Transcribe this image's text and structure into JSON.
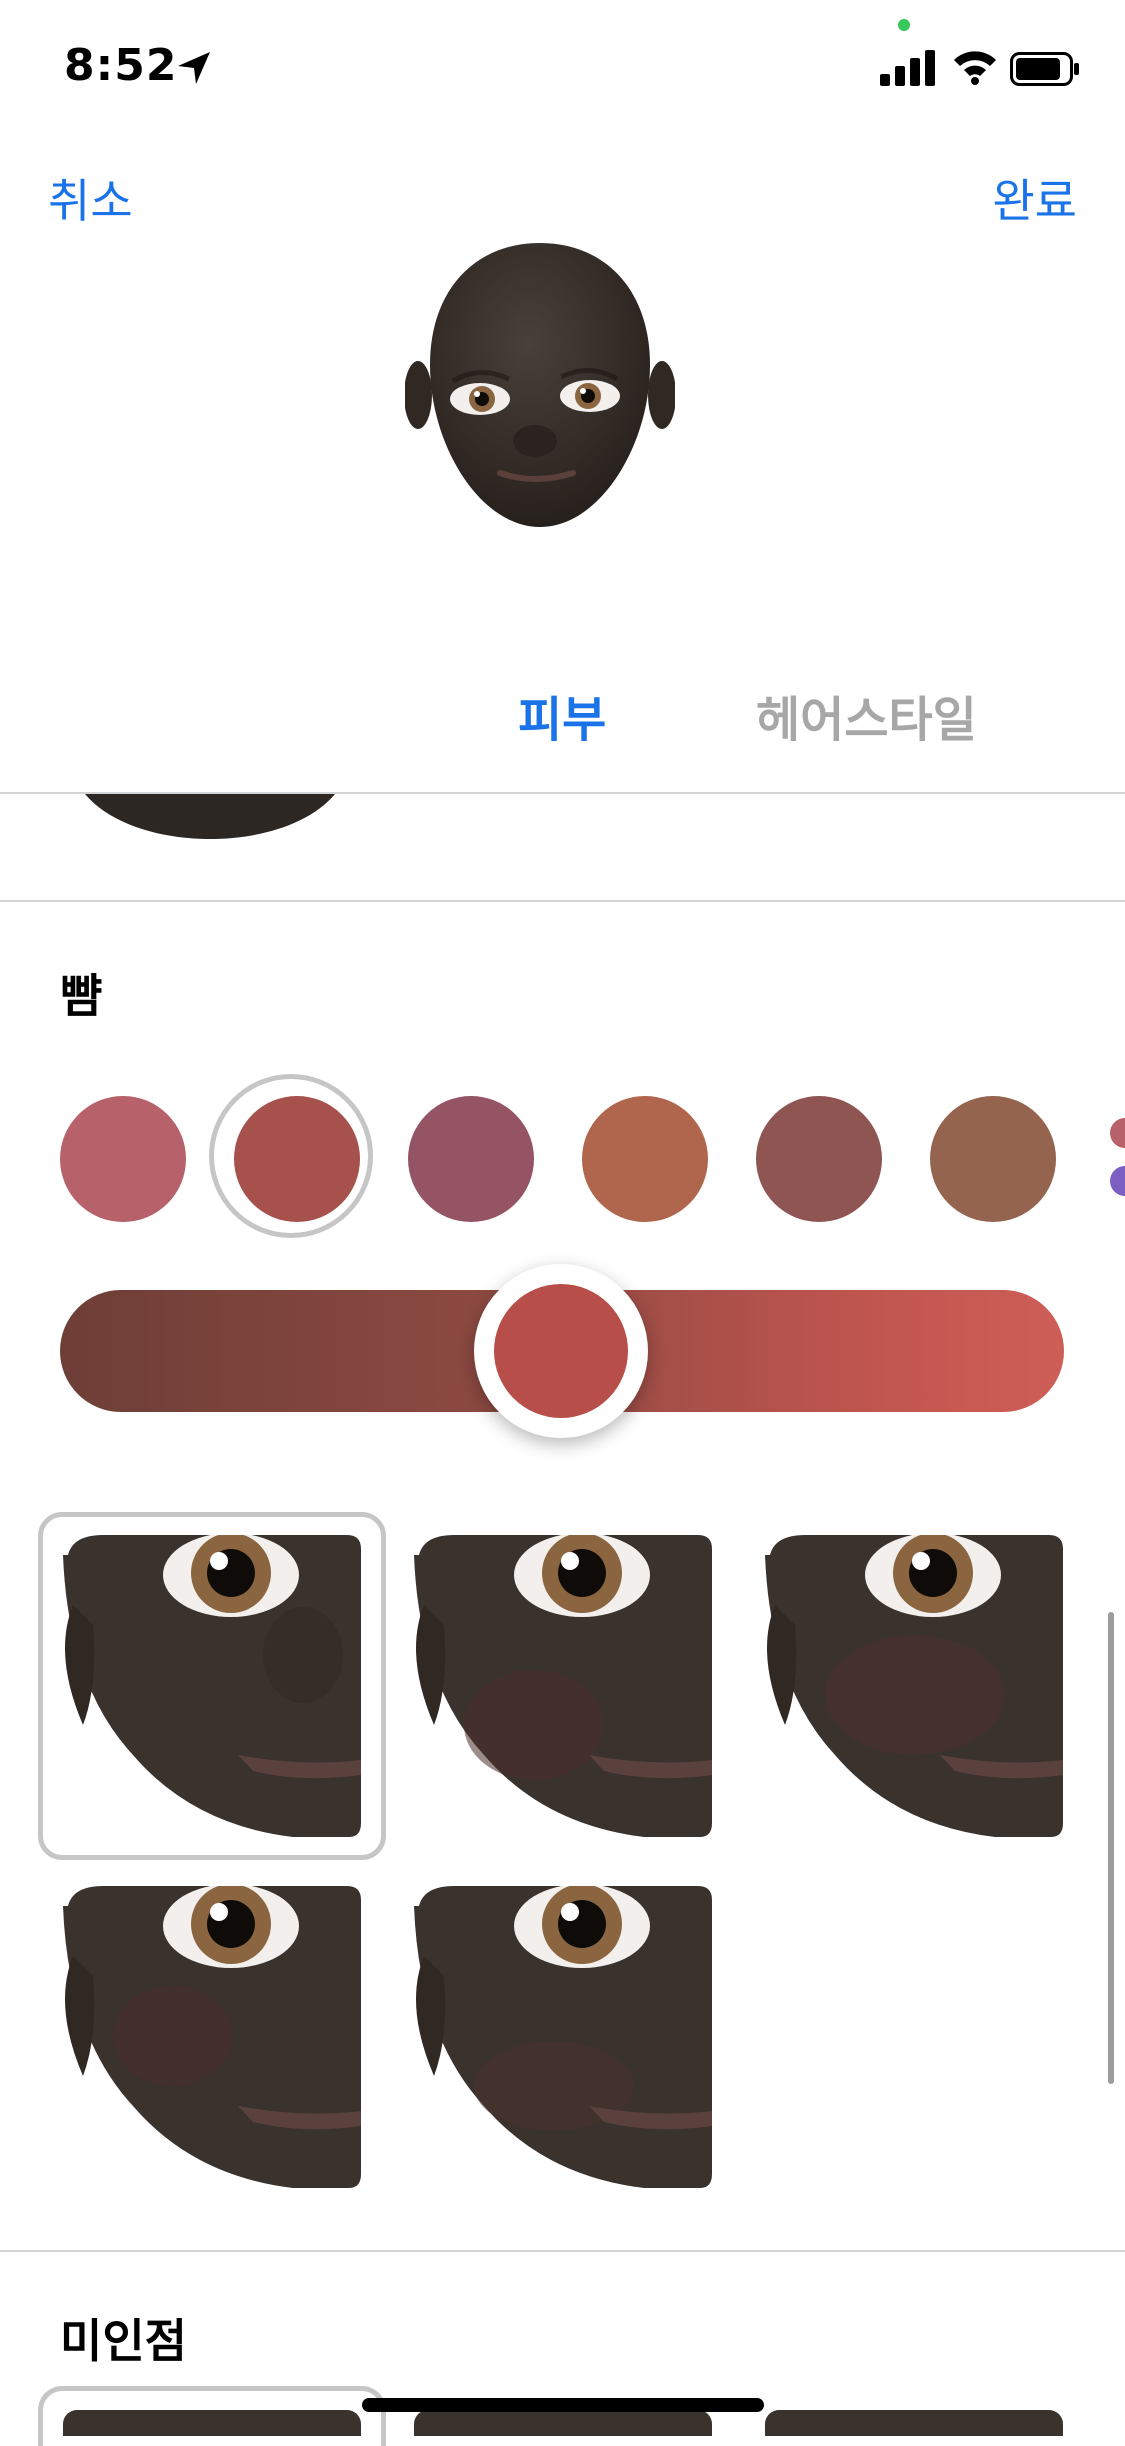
{
  "status_bar": {
    "time": "8:52",
    "icons": [
      "location-arrow-icon",
      "camera-in-use-dot",
      "cellular-signal-icon",
      "wifi-icon",
      "battery-icon"
    ]
  },
  "nav": {
    "cancel_label": "취소",
    "done_label": "완료"
  },
  "tabs": [
    {
      "label": "피부",
      "selected": true
    },
    {
      "label": "헤어스타일",
      "selected": false
    }
  ],
  "cheeks": {
    "title": "뺨",
    "swatches": [
      "#b7616a",
      "#a7514c",
      "#955463",
      "#b0664c",
      "#8e5552",
      "#95644f"
    ],
    "selected_swatch_index": 1,
    "slider_value_fraction": 0.5,
    "slider_color": "#b74e49",
    "options_count": 5,
    "selected_option_index": 0
  },
  "next_section": {
    "title": "미인점"
  },
  "colors": {
    "accent": "#1a73e8",
    "inactive_tab": "#a7a7a7",
    "skin": "#3a322d"
  }
}
